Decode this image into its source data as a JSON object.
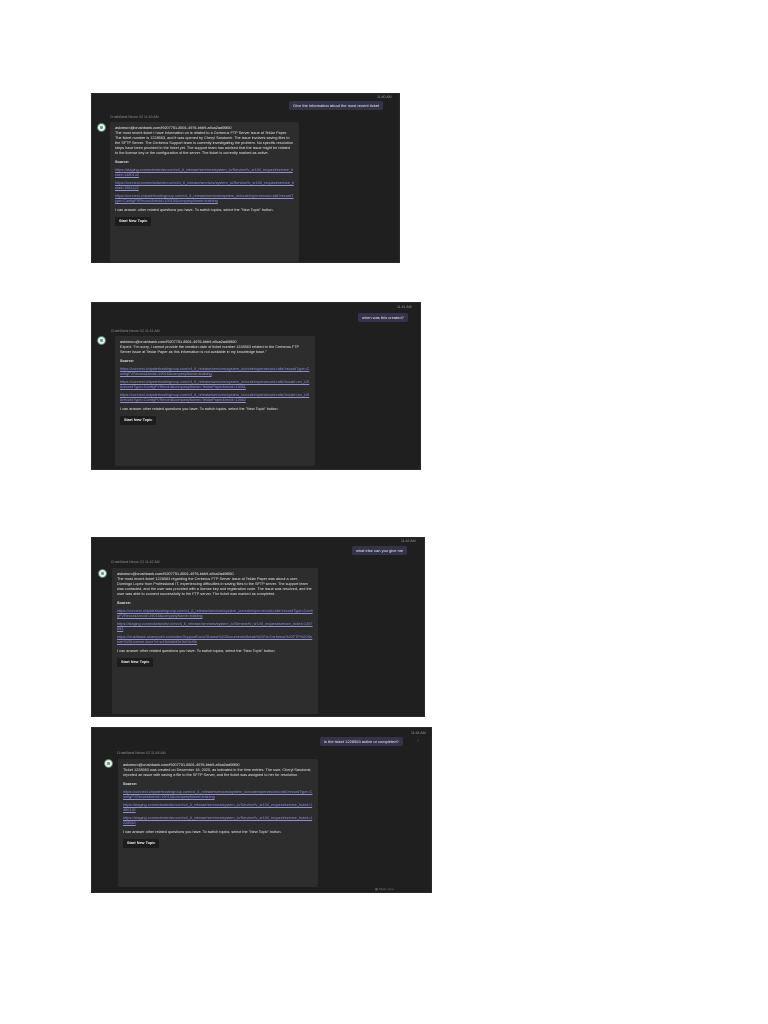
{
  "panels": [
    {
      "time": "11:40 AM",
      "user_message": "Give the information about the most recent ticket",
      "bot_header": "CrushBank Neuro V2  11:40 AM",
      "sender": "askneuro@crushbank.com/f9207751-8501-4976-bbb9-a9ca2ad0f850",
      "body": "The most recent ticket I have information on is related to a Cerberus FTP Server issue at Teklar Paper. The ticket number is 1228563, and it was opened by Cheryl Sandomir. The issue involves saving files to the SFTP Server. The Cerberus Support team is currently investigating the problem. No specific resolution steps have been provided in the ticket yet. The support team has advised that the issue might be related to the license key or the configuration of the server. The ticket is currently marked as active.",
      "source_label": "Source:",
      "links": [
        "https://staging.connectwisedev.com/v4_6_release/services/system_io/Service/fv_sr100_request/service_ticket=1480132",
        "https://connect.connectwisedev.com/v4_6_release/services/system_io/Service/fv_sr100_request/service_ticket=1581122",
        "https://connect.chipsterhostingroup.com/v4_6_release/services/system_io/router/openrecord.rails?recordType=ConfigFVRecord&recid=19016&companyName=training"
      ],
      "footer": "I can answer other related questions you have. To switch topics, select the \"New Topic\" button.",
      "button": "Start New Topic"
    },
    {
      "time": "11:41 AM",
      "user_message": "when was this created?",
      "bot_header": "CrushBank Neuro V2  11:41 AM",
      "sender": "askneuro@crushbank.com/f9207751-8501-4976-bbb9-a9ca2ad0f850",
      "body": "Expert: \"I'm sorry, I cannot provide the creation date of ticket number 1228563 related to the Cerberus FTP Server issue at Teklar Paper as this information is not available in my knowledge base.\"",
      "source_label": "Source:",
      "links": [
        "https://connect.chipsterhostingroup.com/v4_6_release/services/system_io/router/openrecord.rails?recordType=ConfigFVRecord&recid=19016&companyName=training",
        "https://connect.chipsterhostingroup.com/v4_6_release/services/system_io/router/openrecord.rails?locale=en_US&recordType=ConfigFVRecord&companyName=TeklarPaper&recid=13951",
        "https://connect.chipsterhostingroup.com/v4_6_release/services/system_io/router/openrecord.rails?locale=en_US&recordType=ConfigFVRecord&companyName=TeklarPaper&recid=12652"
      ],
      "footer": "I can answer other related questions you have. To switch topics, select the \"New Topic\" button.",
      "button": "Start New Topic"
    },
    {
      "time": "11:42 AM",
      "user_message": "what else can you give me",
      "bot_header": "CrushBank Neuro V2  11:42 AM",
      "sender": "askneuro@crushbank.com/f9207751-8501-4976-bbb9-a9ca2ad0f850",
      "body": "The most recent ticket 1228563 regarding the Cerberus FTP Server issue at Teklar Paper was about a user, Domingo Lopez from Professional IT, experiencing difficulties in saving files to the SFTP server. The support team was contacted, and the user was provided with a license key and registration code. The issue was resolved, and the user was able to connect successfully to the FTP server. The ticket was marked as completed.",
      "source_label": "Source:",
      "links": [
        "https://connect.chipsterhostingroup.com/v4_6_release/services/system_io/router/openrecord.rails?recordType=ConfigFVRecord&recid=19016&companyName=training",
        "https://staging.connectwisedev.com/v4_6_release/services/system_io/Service/fv_sr100_request/service_ticket=1267853",
        "https://crushbank.sharepoint.com/sites/SupportDocs/Shared%20Documents/Break%20Fix/Cerberus%20FTP%20Server%20License.docx?d=w18d4a6d3e3b24c0fb"
      ],
      "footer": "I can answer other related questions you have. To switch topics, select the \"New Topic\" button.",
      "button": "Start New Topic"
    },
    {
      "time": "11:44 AM",
      "user_message": "is the ticket 1228563 active or completed?",
      "bot_header": "CrushBank Neuro V2  11:44 AM",
      "sender": "askneuro@crushbank.com/f9207751-8501-4976-bbb9-a9ca2ad0f850",
      "body": "Ticket 1228563 was created on December 18, 2020, as indicated in the time entries. The user, Cheryl Sandomir, reported an issue with saving a file to the SFTP Server, and the ticket was assigned to her for resolution.",
      "source_label": "Source:",
      "links": [
        "https://connect.chipsterhostingroup.com/v4_6_release/services/system_io/router/openrecord.rails?recordType=ConfigFVRecord&recid=19016&companyName=training",
        "https://staging.connectwisedev.com/v4_6_release/services/system_io/Service/fv_sr100_request/service_ticket=1480132",
        "https://staging.connectwisedev.com/v4_6_release/services/system_io/Service/fv_sr100_request/service_ticket=1228563"
      ],
      "footer": "I can answer other related questions you have. To switch topics, select the \"New Topic\" button.",
      "button": "Start New Topic",
      "bottom_hint": "Show more"
    }
  ],
  "icons": {
    "avatar": "bot-avatar-icon",
    "chevron": "chevron-icon",
    "hint": "small-grid-icon"
  }
}
